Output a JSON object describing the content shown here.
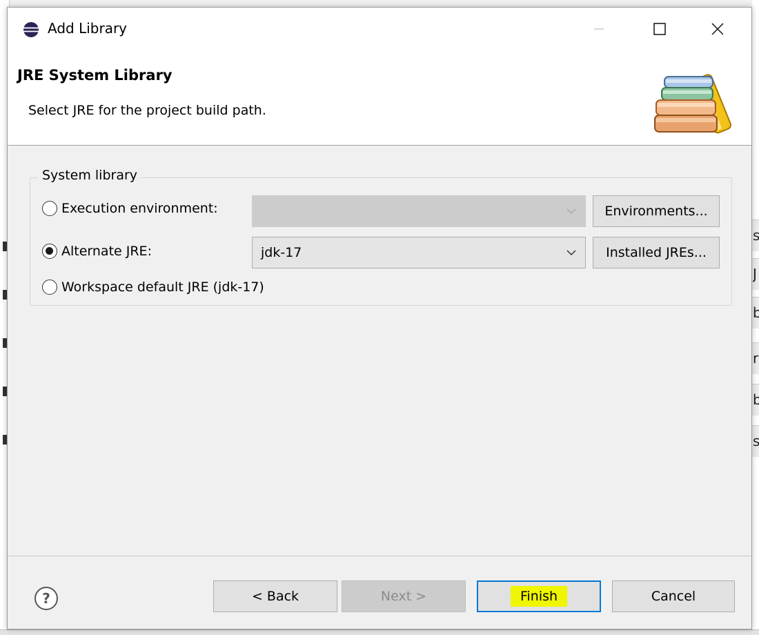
{
  "window": {
    "title": "Add Library"
  },
  "header": {
    "title": "JRE System Library",
    "description": "Select JRE for the project build path."
  },
  "group": {
    "label": "System library"
  },
  "options": {
    "execution_environment": {
      "label": "Execution environment:",
      "checked": false,
      "value": ""
    },
    "alternate_jre": {
      "label": "Alternate JRE:",
      "checked": true,
      "value": "jdk-17"
    },
    "workspace_default": {
      "label": "Workspace default JRE (jdk-17)",
      "checked": false
    }
  },
  "buttons": {
    "environments": "Environments...",
    "installed_jres": "Installed JREs...",
    "back": "< Back",
    "next": "Next >",
    "finish": "Finish",
    "cancel": "Cancel"
  },
  "icons": {
    "app": "eclipse-icon",
    "minimize": "minimize-icon",
    "maximize": "maximize-icon",
    "close": "close-icon",
    "banner": "library-books-icon",
    "help": "help-icon",
    "dropdown": "chevron-down-icon"
  },
  "colors": {
    "accent": "#0078d7",
    "highlight": "#f0f500",
    "dialog_bg": "#f0f0f0"
  },
  "background": {
    "right_glyphs": [
      "s",
      "J",
      "b",
      "r",
      "b",
      "s"
    ]
  }
}
